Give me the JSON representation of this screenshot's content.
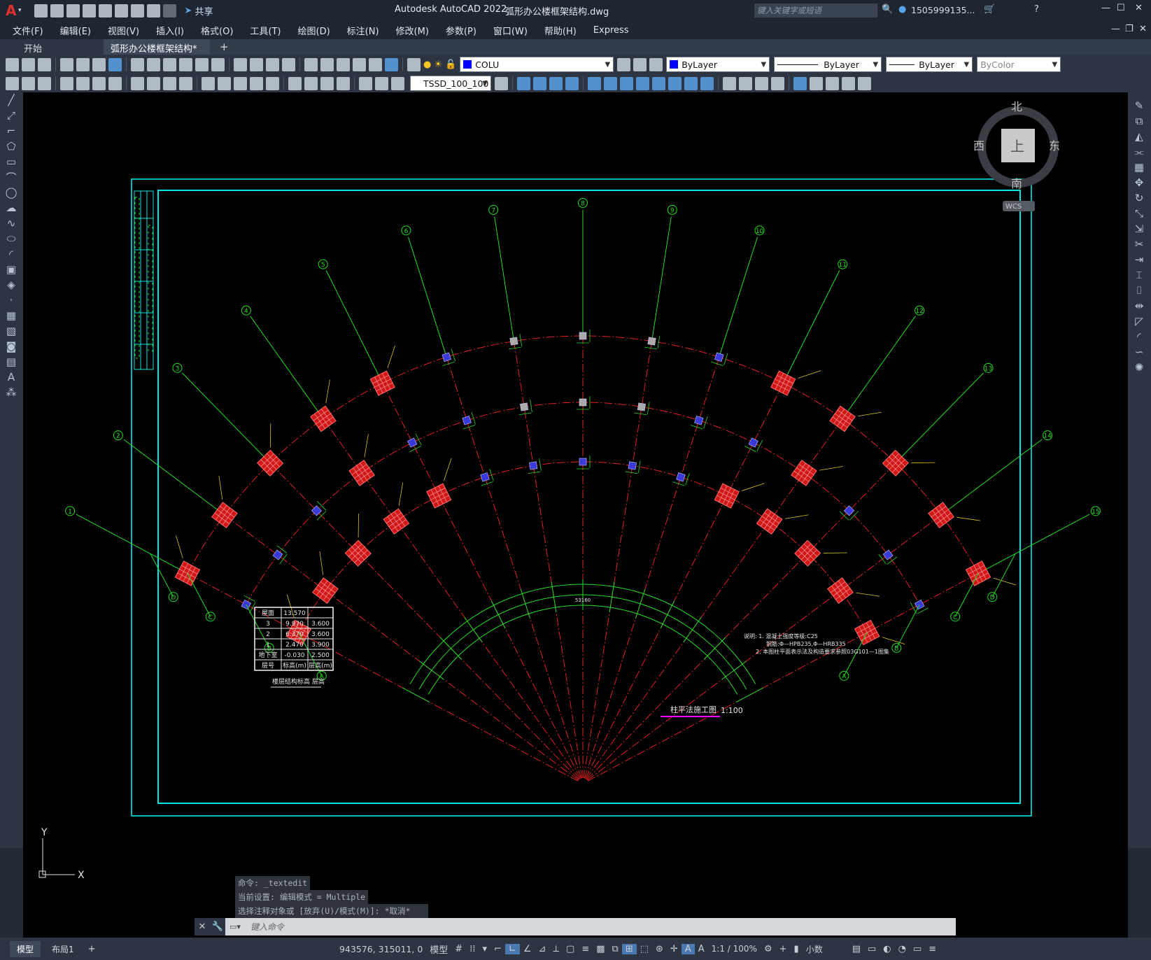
{
  "app": {
    "title": "Autodesk AutoCAD 2022",
    "document": "弧形办公楼框架结构.dwg",
    "share": "共享",
    "search_placeholder": "键入关键字或短语",
    "user": "1505999135...",
    "logo": "A"
  },
  "menu": [
    "文件(F)",
    "编辑(E)",
    "视图(V)",
    "插入(I)",
    "格式(O)",
    "工具(T)",
    "绘图(D)",
    "标注(N)",
    "修改(M)",
    "参数(P)",
    "窗口(W)",
    "帮助(H)",
    "Express"
  ],
  "tabs": [
    {
      "label": "开始"
    },
    {
      "label": "弧形办公楼框架结构*"
    }
  ],
  "toolbar": {
    "layer": "COLU",
    "color": "ByLayer",
    "linetype": "ByLayer",
    "lineweight": "ByLayer",
    "plotstyle": "ByColor",
    "dimstyle": "TSSD_100_100"
  },
  "viewcube": {
    "north": "北",
    "south": "南",
    "east": "东",
    "west": "西",
    "top": "上",
    "wcs": "WCS"
  },
  "drawing": {
    "axes_numbers": [
      "1",
      "2",
      "3",
      "4",
      "5",
      "6",
      "7",
      "8",
      "9",
      "10",
      "11",
      "12",
      "13",
      "14",
      "15"
    ],
    "axes_letters": [
      "A",
      "B",
      "C",
      "D"
    ],
    "level_table": {
      "rows": [
        [
          "屋面",
          "13.570",
          ""
        ],
        [
          "3",
          "9.970",
          "3.600"
        ],
        [
          "2",
          "6.370",
          "3.600"
        ],
        [
          "1",
          "2.470",
          "3.900"
        ],
        [
          "地下室",
          "-0.030",
          "2.500"
        ],
        [
          "层号",
          "标高(m)",
          "层高(m)"
        ]
      ],
      "caption": "楼层结构标高 层高"
    },
    "notes": [
      "说明: 1. 混凝土强度等级:C25",
      "钢筋:Φ—HPB235,Φ—HRB335",
      "2. 本图柱平面表示法及构造要求参照03G101—1图集"
    ],
    "plan_title": "柱平法施工图",
    "scale": "1:100",
    "arc_dim": "53160"
  },
  "ucs": {
    "y": "Y",
    "x": "X"
  },
  "command": {
    "history": [
      "命令: _textedit",
      "当前设置: 编辑模式 = Multiple",
      "选择注释对象或 [放弃(U)/模式(M)]: *取消*"
    ],
    "placeholder": "键入命令"
  },
  "layouts": [
    "模型",
    "布局1"
  ],
  "status": {
    "coords": "943576, 315011, 0",
    "space": "模型",
    "scale": "1:1 / 100%",
    "units": "小数"
  }
}
